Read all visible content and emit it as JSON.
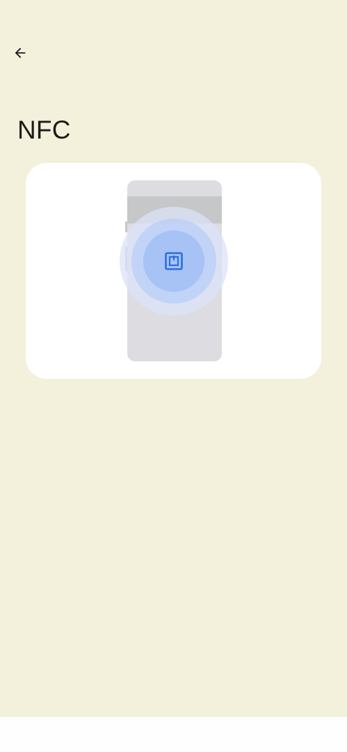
{
  "header": {
    "back_icon": "arrow-left-icon",
    "title": "NFC"
  },
  "illustration": {
    "icon": "nfc-icon",
    "colors": {
      "card_background": "#ffffff",
      "phone_body": "#dddde1",
      "phone_band": "#c6c7c8",
      "pulse_outer": "#e4e9f7",
      "pulse_mid": "#bcd0f6",
      "pulse_inner": "#a7c2f5",
      "nfc_accent": "#2b6fdd"
    }
  },
  "theme": {
    "page_background": "#f3f1dc",
    "text_primary": "#1c1b17"
  }
}
